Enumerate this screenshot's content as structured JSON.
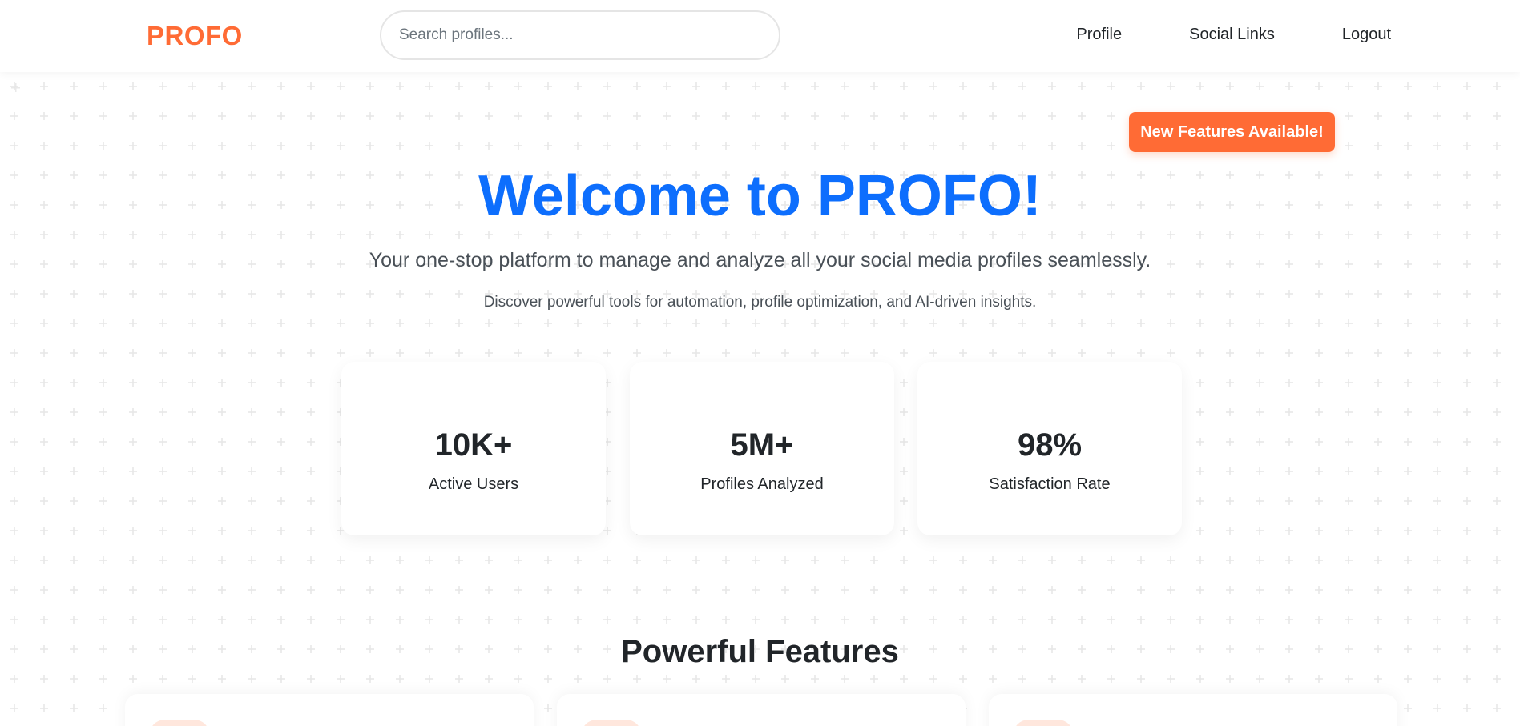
{
  "navbar": {
    "brand": "PROFO",
    "search_placeholder": "Search profiles...",
    "links": [
      {
        "label": "Profile"
      },
      {
        "label": "Social Links"
      },
      {
        "label": "Logout"
      }
    ]
  },
  "hero": {
    "badge": "New Features Available!",
    "title": "Welcome to PROFO!",
    "subtitle": "Your one-stop platform to manage and analyze all your social media profiles seamlessly.",
    "description": "Discover powerful tools for automation, profile optimization, and AI-driven insights."
  },
  "stats": [
    {
      "value": "10K+",
      "label": "Active Users"
    },
    {
      "value": "5M+",
      "label": "Profiles Analyzed"
    },
    {
      "value": "98%",
      "label": "Satisfaction Rate"
    }
  ],
  "features": {
    "title": "Powerful Features"
  },
  "colors": {
    "brand": "#ff6b35",
    "primary": "#0d6efd",
    "text": "#212529"
  }
}
